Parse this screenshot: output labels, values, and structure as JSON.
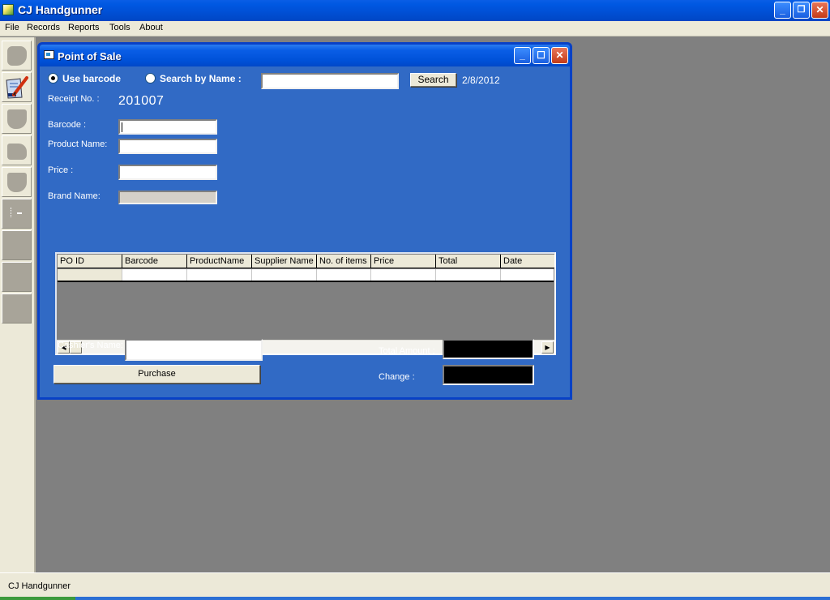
{
  "app": {
    "title": "CJ Handgunner",
    "window_controls": {
      "minimize": "_",
      "restore": "❐",
      "close": "✕"
    }
  },
  "menu": {
    "items": [
      "File",
      "Records",
      "Reports",
      "Tools",
      "About"
    ]
  },
  "toolbar": {
    "tools": [
      {
        "icon": "customers-icon",
        "enabled": false
      },
      {
        "icon": "point-of-sale-icon",
        "enabled": true
      },
      {
        "icon": "shield-icon",
        "enabled": false
      },
      {
        "icon": "truck-icon",
        "enabled": false
      },
      {
        "icon": "shield-icon",
        "enabled": false
      },
      {
        "icon": "settings-icon",
        "enabled": false
      },
      {
        "icon": "blank-icon",
        "enabled": false
      },
      {
        "icon": "blank-icon",
        "enabled": false
      },
      {
        "icon": "blank-icon",
        "enabled": false
      }
    ]
  },
  "pos_window": {
    "title": "Point of Sale",
    "window_controls": {
      "minimize": "_",
      "maximize": "☐",
      "close": "✕"
    },
    "search_mode": {
      "options": [
        {
          "label": "Use barcode",
          "checked": true
        },
        {
          "label": "Search by Name :",
          "checked": false
        }
      ],
      "search_value": "",
      "search_button": "Search",
      "date": "2/8/2012"
    },
    "receipt": {
      "label": "Receipt No. :",
      "value": "201007"
    },
    "fields": {
      "barcode": {
        "label": "Barcode :",
        "value": ""
      },
      "product_name": {
        "label": "Product Name:",
        "value": ""
      },
      "price": {
        "label": "Price :",
        "value": ""
      },
      "brand_name": {
        "label": "Brand Name:",
        "value": ""
      }
    },
    "grid": {
      "columns": [
        "PO ID",
        "Barcode",
        "ProductName",
        "Supplier Name",
        "No. of items",
        "Price",
        "Total",
        "Date"
      ],
      "rows": [
        [
          "",
          "",
          "",
          "",
          "",
          "",
          "",
          ""
        ]
      ],
      "scroll_left": "◀",
      "scroll_right": "▶"
    },
    "cashier": {
      "label": "Cashier's Name:",
      "value": ""
    },
    "purchase_button": "Purchase",
    "total_amount": {
      "label": "Total Amount :",
      "value": ""
    },
    "change": {
      "label": "Change :",
      "value": ""
    }
  },
  "statusbar": {
    "text": "CJ Handgunner"
  }
}
